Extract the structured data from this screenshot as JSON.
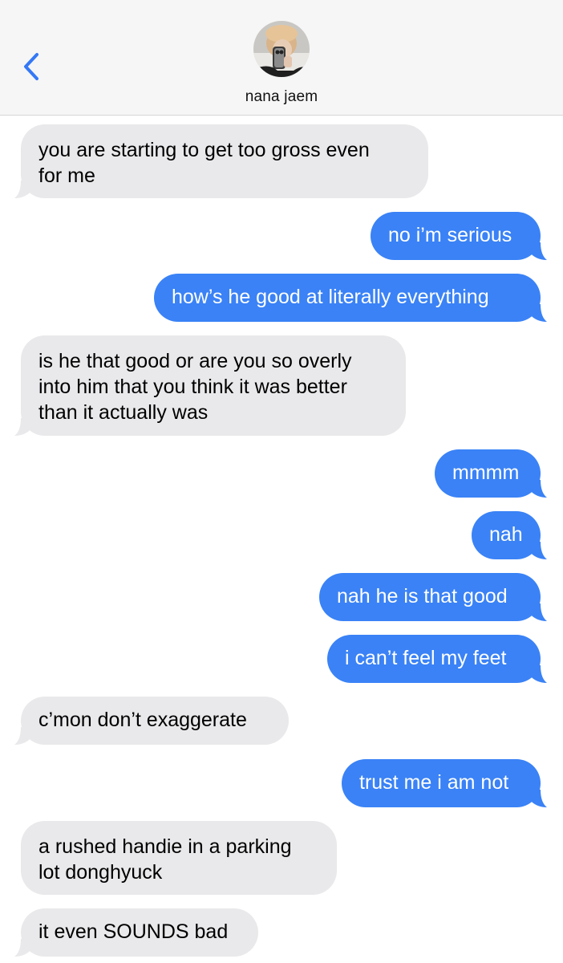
{
  "header": {
    "contact_name": "nana jaem",
    "back_icon": "chevron-left-icon"
  },
  "colors": {
    "sent_bubble": "#3a82f6",
    "received_bubble": "#e9e9eb",
    "header_bg": "#f6f6f6",
    "accent": "#3478f6"
  },
  "messages": [
    {
      "direction": "received",
      "line1": "you are starting to get too gross even",
      "line2": "for me"
    },
    {
      "direction": "sent",
      "text": "no i’m serious"
    },
    {
      "direction": "sent",
      "text": "how’s he good at literally everything"
    },
    {
      "direction": "received",
      "line1": "is he that good or are you so overly",
      "line2": "into him that you think it was better",
      "line3": "than it actually was"
    },
    {
      "direction": "sent",
      "text": "mmmm"
    },
    {
      "direction": "sent",
      "text": "nah"
    },
    {
      "direction": "sent",
      "text": "nah he is that good"
    },
    {
      "direction": "sent",
      "text": "i can’t feel my feet"
    },
    {
      "direction": "received",
      "text": "c’mon don’t exaggerate"
    },
    {
      "direction": "sent",
      "text": "trust me i am not"
    },
    {
      "direction": "received",
      "line1": "a rushed handie in a parking",
      "line2": "lot donghyuck"
    },
    {
      "direction": "received",
      "text": "it even SOUNDS bad"
    }
  ]
}
